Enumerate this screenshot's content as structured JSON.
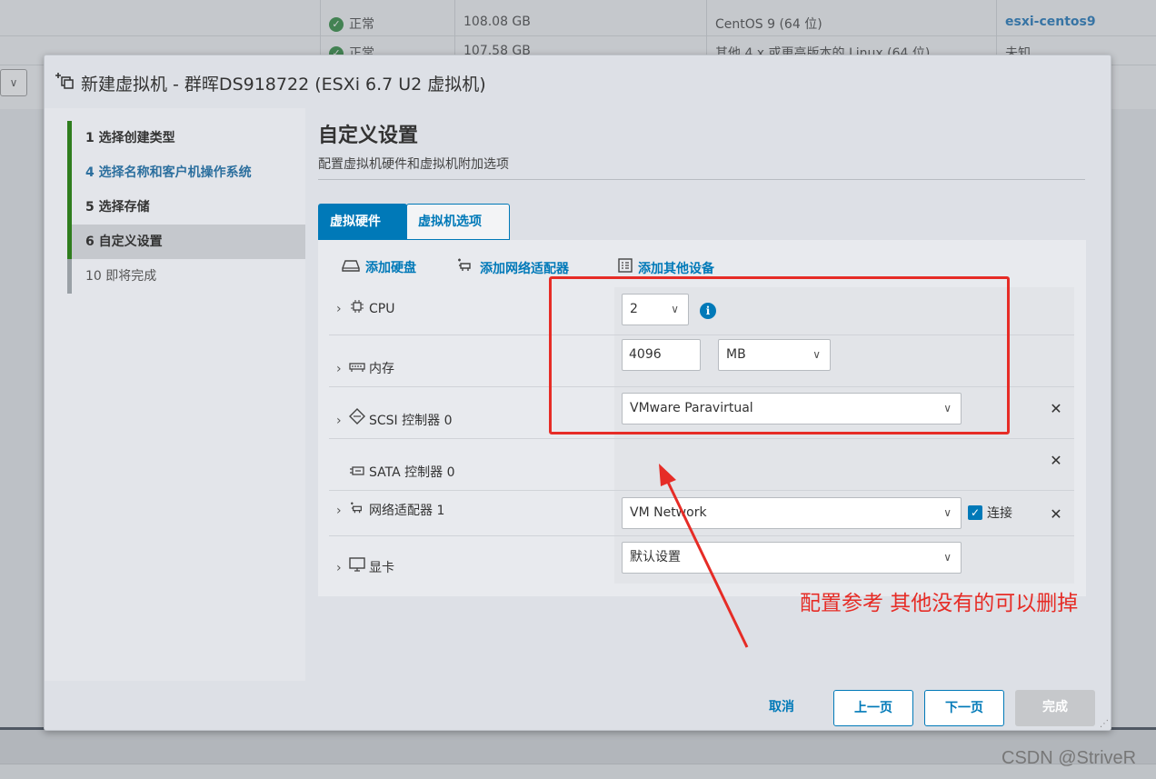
{
  "background": {
    "rows": [
      {
        "status": "正常",
        "size": "108.08 GB",
        "os": "CentOS 9 (64 位)",
        "host": "esxi-centos9"
      },
      {
        "status": "正常",
        "size": "107.58 GB",
        "os": "其他 4.x 或更高版本的 Linux (64 位)",
        "host": "未知"
      }
    ],
    "select_caret": "∨"
  },
  "dialog": {
    "title": "新建虚拟机 - 群晖DS918722 (ESXi 6.7 U2 虚拟机)",
    "nav": [
      {
        "label": "1   选择创建类型"
      },
      {
        "label": "4   选择名称和客户机操作系统"
      },
      {
        "label": "5   选择存储"
      },
      {
        "label": "6   自定义设置"
      },
      {
        "label": "10   即将完成"
      }
    ],
    "page_title": "自定义设置",
    "page_subtitle": "配置虚拟机硬件和虚拟机附加选项",
    "tabs": {
      "hardware": "虚拟硬件",
      "options": "虚拟机选项"
    },
    "toolbar": {
      "add_disk": "添加硬盘",
      "add_nic": "添加网络适配器",
      "add_other": "添加其他设备"
    },
    "hardware": {
      "cpu": {
        "label": "CPU",
        "value": "2"
      },
      "memory": {
        "label": "内存",
        "value": "4096",
        "unit": "MB"
      },
      "scsi": {
        "label": "SCSI 控制器 0",
        "value": "VMware Paravirtual"
      },
      "sata": {
        "label": "SATA 控制器 0"
      },
      "network": {
        "label": "网络适配器 1",
        "value": "VM Network",
        "connect_label": "连接"
      },
      "display": {
        "label": "显卡",
        "value": "默认设置"
      }
    },
    "footer": {
      "cancel": "取消",
      "back": "上一页",
      "next": "下一页",
      "finish": "完成"
    }
  },
  "annotation": {
    "text": "配置参考 其他没有的可以删掉",
    "color": "#e62c26"
  },
  "watermark": "CSDN @StriveR",
  "colors": {
    "accent": "#0079b8",
    "nav_done": "#2f7d1e",
    "ok": "#2d8a3e"
  }
}
